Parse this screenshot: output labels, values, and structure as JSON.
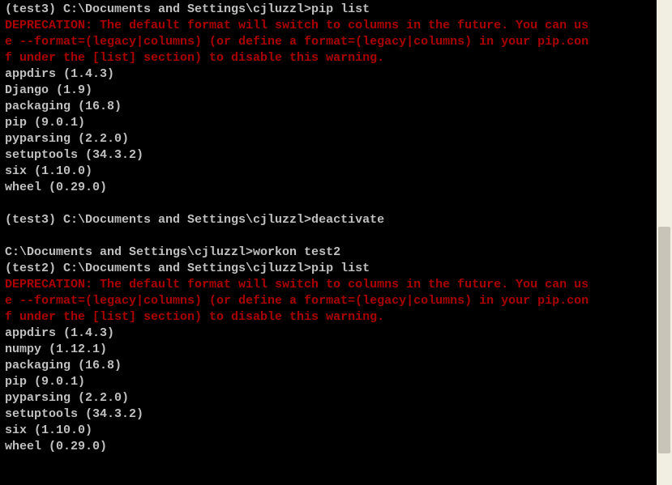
{
  "terminal": {
    "block1": {
      "prompt": "(test3) C:\\Documents and Settings\\cjluzzl>pip list",
      "warning_l1": "DEPRECATION: The default format will switch to columns in the future. You can us",
      "warning_l2": "e --format=(legacy|columns) (or define a format=(legacy|columns) in your pip.con",
      "warning_l3": "f under the [list] section) to disable this warning.",
      "packages": [
        "appdirs (1.4.3)",
        "Django (1.9)",
        "packaging (16.8)",
        "pip (9.0.1)",
        "pyparsing (2.2.0)",
        "setuptools (34.3.2)",
        "six (1.10.0)",
        "wheel (0.29.0)"
      ]
    },
    "block2": {
      "prompt": "(test3) C:\\Documents and Settings\\cjluzzl>deactivate"
    },
    "block3": {
      "prompt1": "C:\\Documents and Settings\\cjluzzl>workon test2",
      "prompt2": "(test2) C:\\Documents and Settings\\cjluzzl>pip list",
      "warning_l1": "DEPRECATION: The default format will switch to columns in the future. You can us",
      "warning_l2": "e --format=(legacy|columns) (or define a format=(legacy|columns) in your pip.con",
      "warning_l3": "f under the [list] section) to disable this warning.",
      "packages": [
        "appdirs (1.4.3)",
        "numpy (1.12.1)",
        "packaging (16.8)",
        "pip (9.0.1)",
        "pyparsing (2.2.0)",
        "setuptools (34.3.2)",
        "six (1.10.0)",
        "wheel (0.29.0)"
      ]
    }
  }
}
